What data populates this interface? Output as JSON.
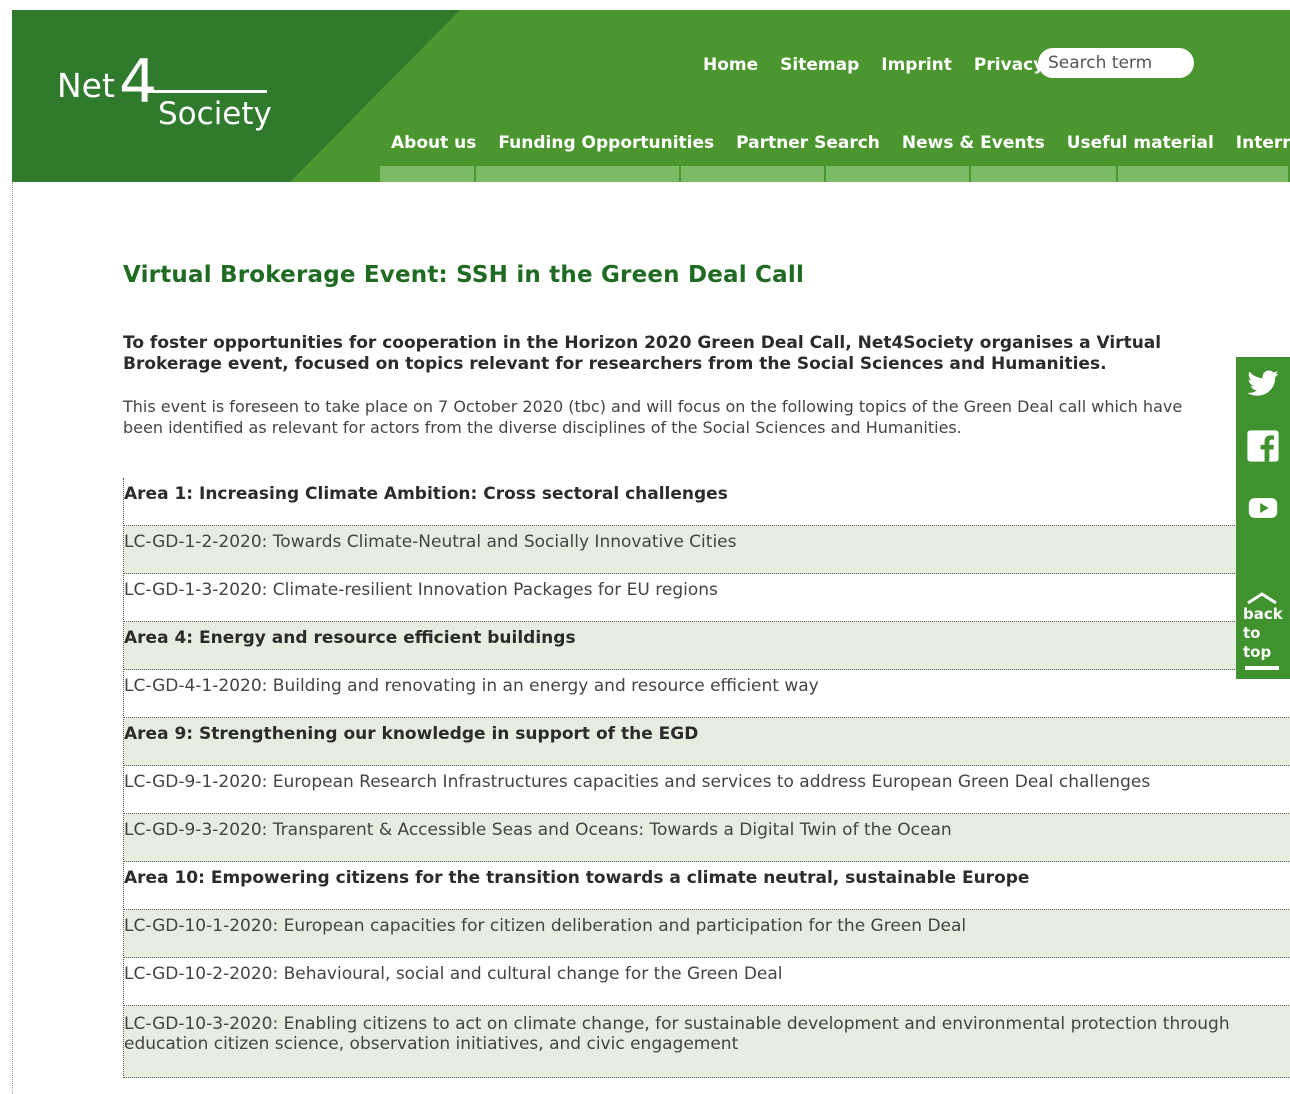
{
  "logo": {
    "net": "Net",
    "four": "4",
    "society": "Society"
  },
  "top_nav": [
    "Home",
    "Sitemap",
    "Imprint",
    "Privacy"
  ],
  "search": {
    "placeholder": "Search term"
  },
  "main_nav": [
    "About us",
    "Funding Opportunities",
    "Partner Search",
    "News & Events",
    "Useful material",
    "Internal website"
  ],
  "page": {
    "title": "Virtual Brokerage Event: SSH in the Green Deal Call",
    "lead": "To foster opportunities for cooperation in the Horizon 2020 Green Deal Call, Net4Society organises a Virtual Brokerage event, focused on topics relevant for researchers from the Social Sciences and Humanities.",
    "body": "This event is foreseen to take place on 7 October 2020 (tbc) and will focus on the following topics of the Green Deal call which have been identified as relevant for actors from the diverse disciplines of the Social Sciences and Humanities."
  },
  "topics": [
    {
      "text": "Area 1: Increasing Climate Ambition: Cross sectoral challenges",
      "type": "area"
    },
    {
      "text": "LC-GD-1-2-2020: Towards Climate-Neutral and Socially Innovative Cities",
      "type": "topic"
    },
    {
      "text": "LC-GD-1-3-2020: Climate-resilient Innovation Packages for EU regions",
      "type": "topic"
    },
    {
      "text": "Area 4: Energy and resource efficient buildings",
      "type": "area"
    },
    {
      "text": "LC-GD-4-1-2020: Building and renovating in an energy and resource efficient way",
      "type": "topic"
    },
    {
      "text": "Area 9: Strengthening our knowledge in support of the EGD",
      "type": "area"
    },
    {
      "text": "LC-GD-9-1-2020: European Research Infrastructures capacities and services to address European Green Deal challenges",
      "type": "topic"
    },
    {
      "text": "LC-GD-9-3-2020: Transparent & Accessible Seas and Oceans: Towards a Digital Twin of the Ocean",
      "type": "topic"
    },
    {
      "text": "Area 10: Empowering citizens for the transition towards a climate neutral, sustainable Europe",
      "type": "area"
    },
    {
      "text": "LC-GD-10-1-2020: European capacities for citizen deliberation and participation for the Green Deal",
      "type": "topic"
    },
    {
      "text": "LC-GD-10-2-2020: Behavioural, social and cultural change for the Green Deal",
      "type": "topic"
    },
    {
      "text": "LC-GD-10-3-2020: Enabling citizens to act on climate change, for sustainable development and environmental protection through education citizen science, observation initiatives, and civic engagement",
      "type": "topic"
    }
  ],
  "social": {
    "icons": [
      "twitter-icon",
      "facebook-icon",
      "youtube-icon"
    ],
    "back_to_top": "back\nto\ntop"
  },
  "colors": {
    "header_green": "#4b962f",
    "header_dark_green": "#2f7a2d",
    "title_green": "#1f6b22",
    "row_shade": "#e7ede1",
    "nav_bar": "#7cbb66"
  }
}
